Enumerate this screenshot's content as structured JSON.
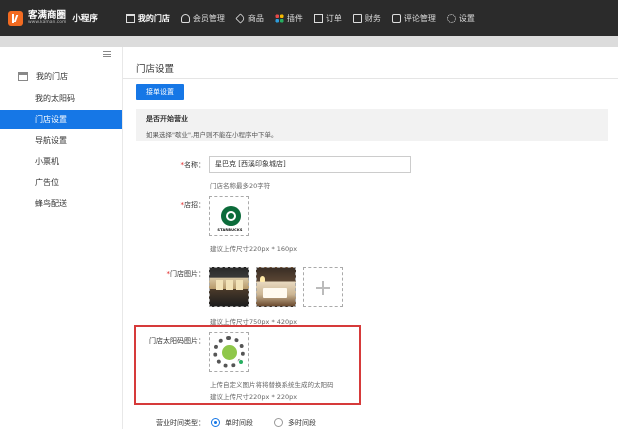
{
  "topbar": {
    "logo_name": "客满商圈",
    "logo_url": "www.kaman.com",
    "logo_sub": "小程序",
    "nav": [
      {
        "label": "我的门店",
        "icon": "store-icon",
        "active": true
      },
      {
        "label": "会员管理",
        "icon": "user-icon",
        "active": false
      },
      {
        "label": "商品",
        "icon": "tag-icon",
        "active": false
      },
      {
        "label": "插件",
        "icon": "apps-icon",
        "active": false
      },
      {
        "label": "订单",
        "icon": "order-icon",
        "active": false
      },
      {
        "label": "财务",
        "icon": "finance-icon",
        "active": false
      },
      {
        "label": "评论管理",
        "icon": "comment-icon",
        "active": false
      },
      {
        "label": "设置",
        "icon": "gear-icon",
        "active": false
      }
    ]
  },
  "sidebar": {
    "heading": "我的门店",
    "items": [
      {
        "label": "我的太阳码",
        "active": false
      },
      {
        "label": "门店设置",
        "active": true
      },
      {
        "label": "导航设置",
        "active": false
      },
      {
        "label": "小票机",
        "active": false
      },
      {
        "label": "广告位",
        "active": false
      },
      {
        "label": "蜂鸟配送",
        "active": false
      }
    ]
  },
  "main": {
    "title": "门店设置",
    "tab_label": "接单设置",
    "notice": {
      "title": "是否开始营业",
      "desc": "如果选择\"歇业\",用户则不能在小程序中下单。"
    },
    "name": {
      "label": "名称：",
      "value": "星巴克 [西溪印象城店]",
      "hint": "门店名称最多20字符"
    },
    "logo": {
      "label": "店招：",
      "brand_text": "STARBUCKS",
      "hint": "建议上传尺寸220px * 160px"
    },
    "photos": {
      "label": "门店图片：",
      "hint": "建议上传尺寸750px * 420px"
    },
    "sun_code": {
      "label": "门店太阳码图片：",
      "hint1": "上传自定义图片将将替换系统生成的太阳码",
      "hint2": "建议上传尺寸220px * 220px"
    },
    "business_time": {
      "label": "营业时间类型：",
      "options": [
        {
          "label": "单时间段",
          "checked": true
        },
        {
          "label": "多时间段",
          "checked": false
        }
      ]
    }
  },
  "colors": {
    "topbar_bg": "#2b2b2b",
    "accent": "#1677e6",
    "logo_orange": "#f26b21",
    "highlight_red": "#d63a3a"
  }
}
